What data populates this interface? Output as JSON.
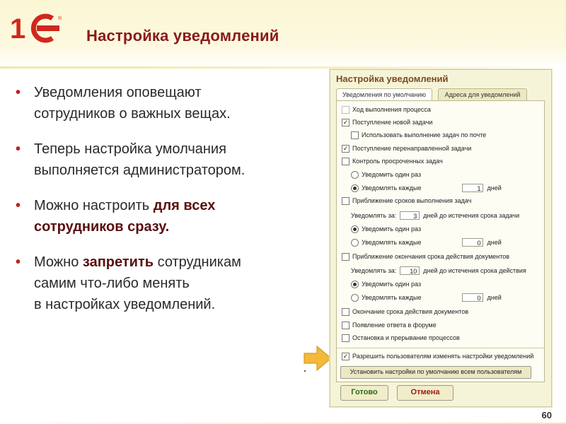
{
  "slide": {
    "title": "Настройка уведомлений",
    "page_number": "60",
    "logo_text": "1С"
  },
  "bullets": [
    {
      "lines": [
        "Уведомления оповещают",
        "сотрудников о важных вещах."
      ]
    },
    {
      "lines": [
        "Теперь настройка умолчания",
        "выполняется администратором."
      ]
    },
    {
      "pre": "Можно настроить ",
      "bold": "для всех",
      "bold2": "сотрудников сразу",
      "post": "."
    },
    {
      "pre": "Можно ",
      "bold": "запретить",
      "post": " сотрудникам",
      "line2": "самим что-либо менять",
      "line3": "в настройках уведомлений."
    }
  ],
  "dialog": {
    "title": "Настройка уведомлений",
    "tabs": [
      "Уведомления по умолчанию",
      "Адреса для уведомлений"
    ],
    "options": {
      "task_progress": "Ход выполнения процесса",
      "new_task": "Поступление новой задачи",
      "use_mail": "Использовать выполнение задач по почте",
      "redirected_task": "Поступление перенаправленной задачи",
      "overdue_control": "Контроль просроченных задач",
      "notify_once": "Уведомить один раз",
      "notify_every": "Уведомлять каждые",
      "days": "дней",
      "deadline_approach": "Приближение сроков выполнения задач",
      "notify_before": "Уведомлять за:",
      "days_before_task": "дней до истечения срока задачи",
      "doc_expiry_approach": "Приближение окончания срока действия документов",
      "days_before_doc": "дней до истечения срока действия",
      "doc_expiry": "Окончание срока действия документов",
      "forum_reply": "Появление ответа в форуме",
      "process_stop": "Остановка и прерывание процессов",
      "allow_users": "Разрешить пользователям изменять настройки уведомлений"
    },
    "values": {
      "overdue_every": "1",
      "deadline_before": "3",
      "deadline_every": "0",
      "doc_before": "10",
      "doc_every": "0"
    },
    "apply_all_button": "Установить настройки по умолчанию всем пользователям",
    "ok_button": "Готово",
    "cancel_button": "Отмена"
  },
  "colors": {
    "title": "#8b1a1a",
    "bullet": "#c0201d",
    "logo": "#d1271c",
    "arrow": "#f2b93a"
  }
}
